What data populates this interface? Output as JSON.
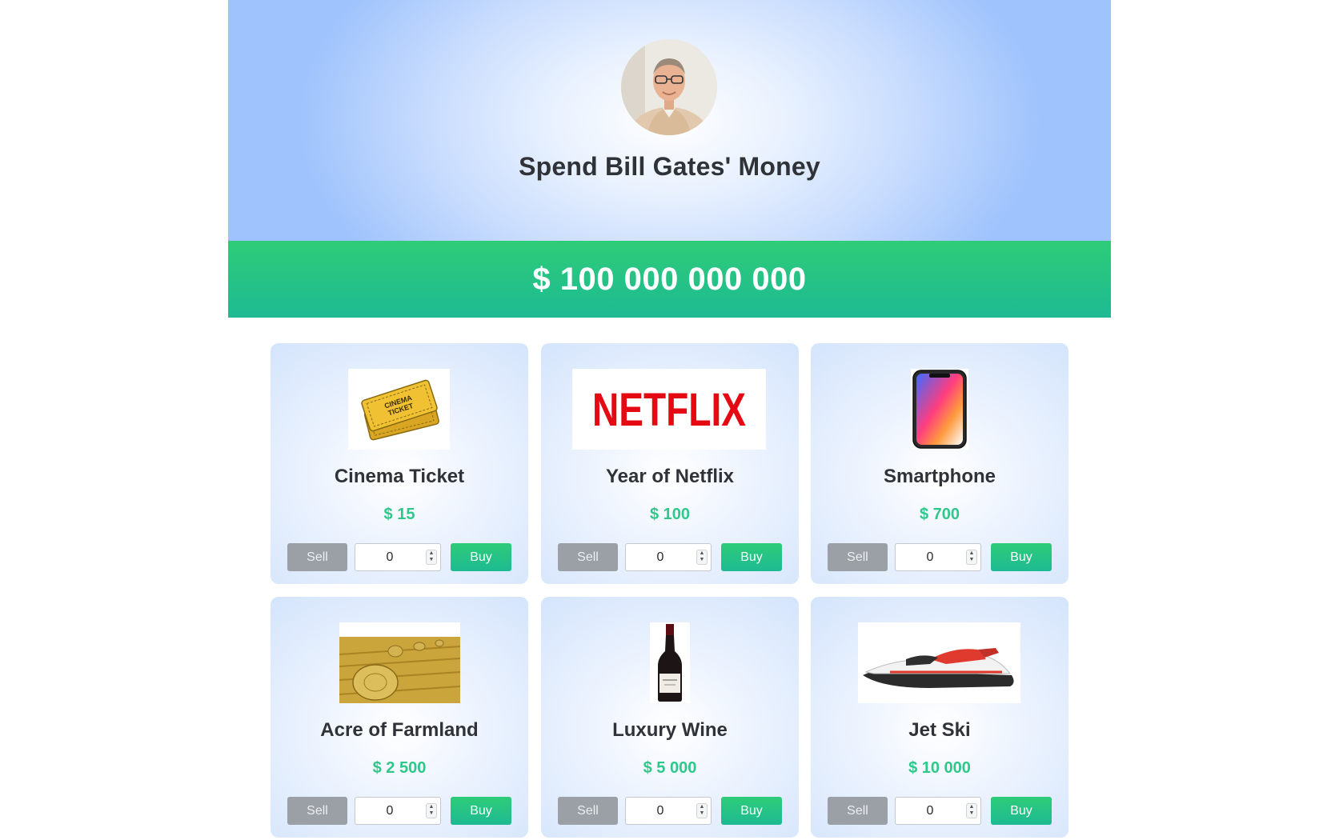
{
  "header": {
    "title": "Spend Bill Gates' Money",
    "avatar_icon": "bill-gates-avatar"
  },
  "balance": "$ 100 000 000 000",
  "colors": {
    "accent_green": "#2ecc78",
    "price_green": "#2fc88a",
    "sell_gray": "#9aa0a6",
    "hero_blue": "#9fc3fc"
  },
  "products": [
    {
      "name": "Cinema Ticket",
      "price": "$ 15",
      "quantity": "0",
      "sell_label": "Sell",
      "buy_label": "Buy",
      "icon": "cinema-ticket-icon"
    },
    {
      "name": "Year of Netflix",
      "price": "$ 100",
      "quantity": "0",
      "sell_label": "Sell",
      "buy_label": "Buy",
      "icon": "netflix-logo",
      "logo_text": "NETFLIX"
    },
    {
      "name": "Smartphone",
      "price": "$ 700",
      "quantity": "0",
      "sell_label": "Sell",
      "buy_label": "Buy",
      "icon": "smartphone-icon"
    },
    {
      "name": "Acre of Farmland",
      "price": "$ 2 500",
      "quantity": "0",
      "sell_label": "Sell",
      "buy_label": "Buy",
      "icon": "farmland-icon"
    },
    {
      "name": "Luxury Wine",
      "price": "$ 5 000",
      "quantity": "0",
      "sell_label": "Sell",
      "buy_label": "Buy",
      "icon": "wine-bottle-icon"
    },
    {
      "name": "Jet Ski",
      "price": "$ 10 000",
      "quantity": "0",
      "sell_label": "Sell",
      "buy_label": "Buy",
      "icon": "jet-ski-icon"
    }
  ]
}
